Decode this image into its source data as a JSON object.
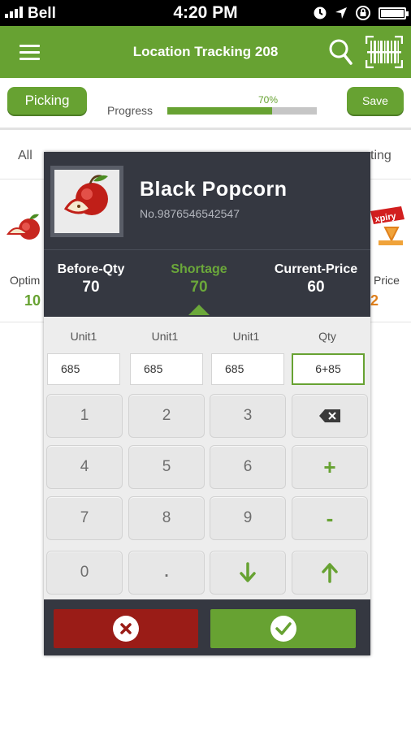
{
  "status_bar": {
    "carrier": "Bell",
    "time": "4:20 PM"
  },
  "header": {
    "title": "Location Tracking 208"
  },
  "toolbar": {
    "picking_label": "Picking",
    "progress_label": "Progress",
    "progress_text": "70%",
    "progress_value": 0.7,
    "save_label": "Save"
  },
  "background": {
    "filter_all": "All",
    "filter_right": "ting",
    "left_item_label": "Optim",
    "left_item_value": "10",
    "right_item_label": "Price",
    "right_item_value": "2",
    "expiry_text": "xpiry"
  },
  "product": {
    "name": "Black Popcorn",
    "number": "No.9876546542547"
  },
  "stats": [
    {
      "key": "Before-Qty",
      "value": "70"
    },
    {
      "key": "Shortage",
      "value": "70"
    },
    {
      "key": "Current-Price",
      "value": "60"
    }
  ],
  "units": [
    {
      "label": "Unit1",
      "value": "685"
    },
    {
      "label": "Unit1",
      "value": "685"
    },
    {
      "label": "Unit1",
      "value": "685"
    },
    {
      "label": "Qty",
      "value": "6+85"
    }
  ],
  "keypad": {
    "rows": [
      [
        "1",
        "2",
        "3",
        "backspace"
      ],
      [
        "4",
        "5",
        "6",
        "+"
      ],
      [
        "7",
        "8",
        "9",
        "-"
      ],
      [
        "0",
        ".",
        "down",
        "up"
      ]
    ]
  },
  "colors": {
    "accent": "#67a232",
    "modal_bg": "#353841",
    "cancel": "#9a1c17",
    "orange": "#e0801c"
  }
}
